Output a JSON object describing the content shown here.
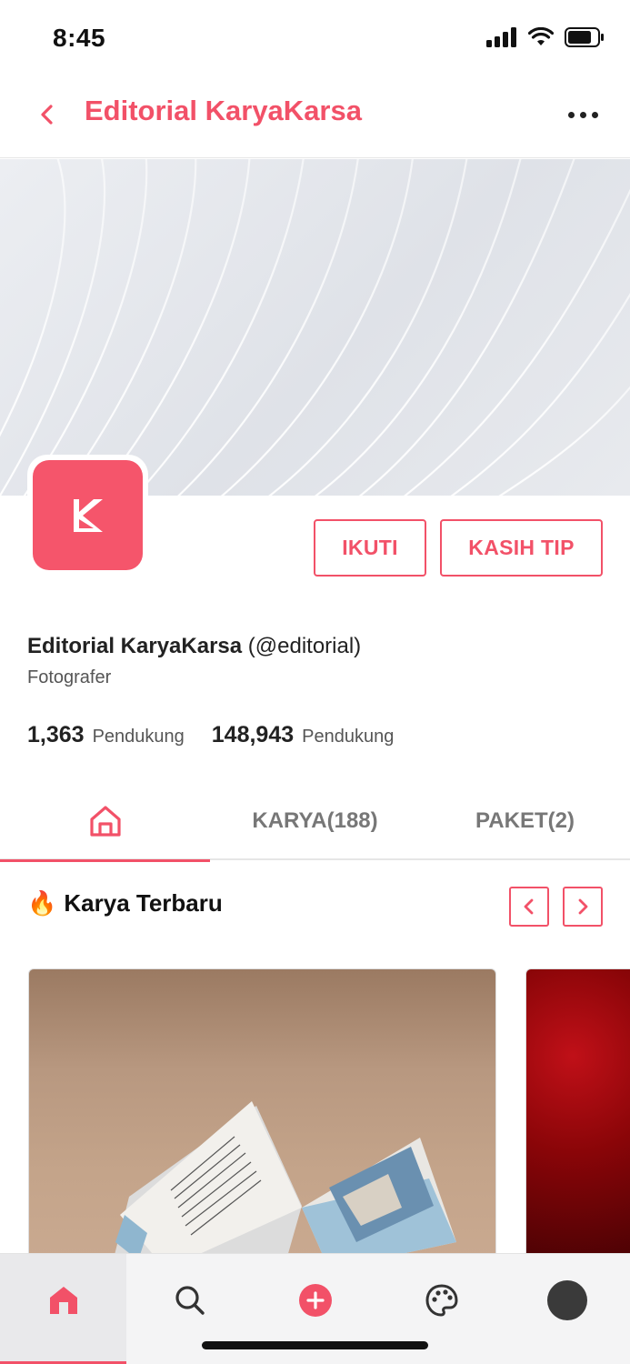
{
  "status_bar": {
    "time": "8:45"
  },
  "header": {
    "title": "Editorial KaryaKarsa",
    "back_icon": "chevron-left-icon",
    "more_icon": "more-horizontal-icon"
  },
  "profile": {
    "display_name": "Editorial KaryaKarsa",
    "handle": "(@editorial)",
    "role": "Fotografer",
    "follow_label": "IKUTI",
    "tip_label": "KASIH TIP",
    "stats": [
      {
        "value": "1,363",
        "label": "Pendukung"
      },
      {
        "value": "148,943",
        "label": "Pendukung"
      }
    ]
  },
  "tabs": [
    {
      "icon": "home-icon",
      "label": "",
      "active": true
    },
    {
      "label": "KARYA(188)",
      "active": false
    },
    {
      "label": "PAKET(2)",
      "active": false
    }
  ],
  "section": {
    "emoji": "🔥",
    "title": "Karya Terbaru"
  },
  "bottom_nav": [
    {
      "icon": "home-icon",
      "active": true
    },
    {
      "icon": "search-icon",
      "active": false
    },
    {
      "icon": "plus-circle-icon",
      "active": false
    },
    {
      "icon": "palette-icon",
      "active": false
    },
    {
      "icon": "avatar-icon",
      "active": false
    }
  ],
  "colors": {
    "accent": "#F25168",
    "text": "#222222",
    "muted": "#555555"
  }
}
